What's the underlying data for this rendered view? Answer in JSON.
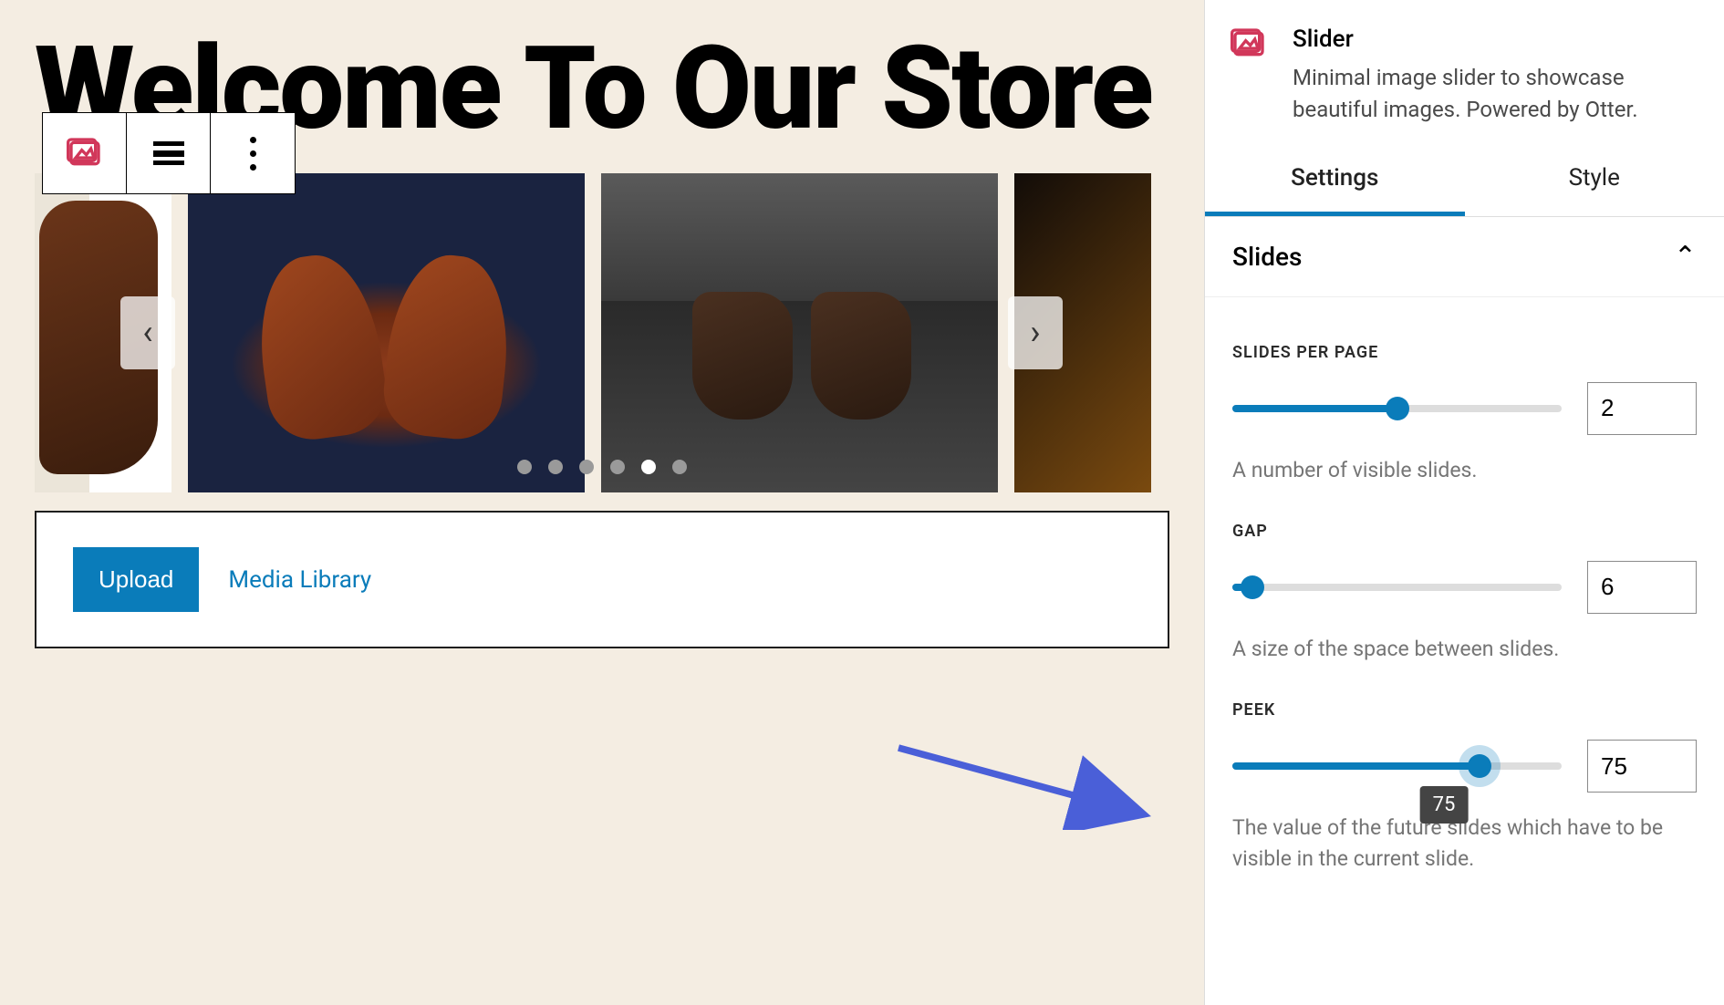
{
  "page": {
    "title": "Welcome To Our Store"
  },
  "toolbar": {
    "block_icon": "slider-icon",
    "align_icon": "align-icon",
    "more_icon": "more-icon"
  },
  "slider": {
    "prev_label": "‹",
    "next_label": "›",
    "dot_count": 6,
    "active_dot": 4
  },
  "media": {
    "upload_label": "Upload",
    "library_label": "Media Library"
  },
  "sidebar": {
    "block_name": "Slider",
    "block_desc": "Minimal image slider to showcase beautiful images. Powered by Otter.",
    "tabs": {
      "settings": "Settings",
      "style": "Style"
    },
    "panel_title": "Slides",
    "controls": {
      "slides_per_page": {
        "label": "SLIDES PER PAGE",
        "value": "2",
        "help": "A number of visible slides.",
        "percent": 50
      },
      "gap": {
        "label": "GAP",
        "value": "6",
        "help": "A size of the space between slides.",
        "percent": 6
      },
      "peek": {
        "label": "PEEK",
        "value": "75",
        "tooltip": "75",
        "help": "The value of the future slides which have to be visible in the current slide.",
        "percent": 75
      }
    }
  }
}
